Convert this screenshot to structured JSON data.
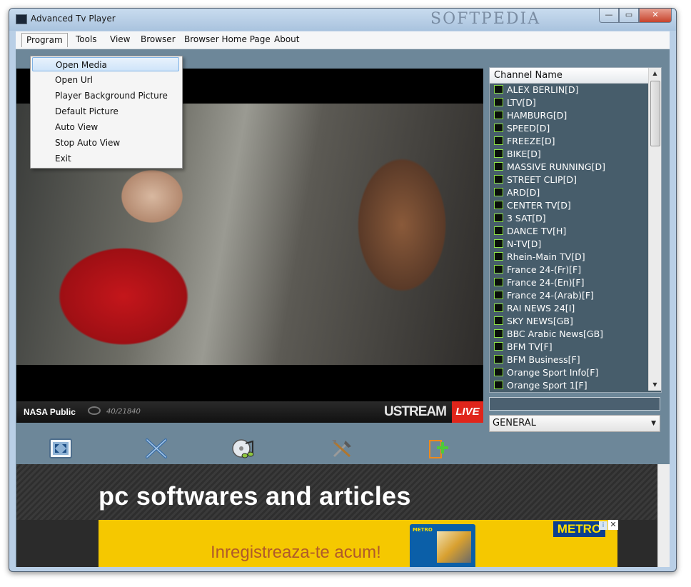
{
  "window": {
    "title": "Advanced Tv Player",
    "watermark": "SOFTPEDIA"
  },
  "window_controls": {
    "minimize": "—",
    "maximize": "▭",
    "close": "✕"
  },
  "menu": {
    "items": [
      "Program",
      "Tools",
      "View",
      "Browser",
      "Browser Home Page",
      "About"
    ],
    "open_menu": "Program",
    "dropdown_items": [
      "Open Media",
      "Open Url",
      "Player Background Picture",
      "Default Picture",
      "Auto View",
      "Stop Auto View",
      "Exit"
    ],
    "highlighted_item": "Open Media"
  },
  "video": {
    "stream_name": "NASA Public",
    "viewers": "40/21840",
    "brand": "USTREAM",
    "live_label": "LIVE"
  },
  "channels": {
    "header": "Channel Name",
    "items": [
      "ALEX BERLIN[D]",
      "LTV[D]",
      "HAMBURG[D]",
      "SPEED[D]",
      "FREEZE[D]",
      "BIKE[D]",
      "MASSIVE RUNNING[D]",
      "STREET CLIP[D]",
      "ARD[D]",
      "CENTER TV[D]",
      "3 SAT[D]",
      "DANCE TV[H]",
      "N-TV[D]",
      "Rhein-Main TV[D]",
      "France 24-(Fr)[F]",
      "France 24-(En)[F]",
      "France 24-(Arab)[F]",
      "RAI NEWS 24[I]",
      "SKY NEWS[GB]",
      "BBC Arabic News[GB]",
      "BFM TV[F]",
      "BFM Business[F]",
      "Orange Sport Info[F]",
      "Orange Sport 1[F]"
    ],
    "search_value": "",
    "category": "GENERAL"
  },
  "toolbar": {
    "icons": [
      "fullscreen-icon",
      "cross-arrows-icon",
      "music-disc-icon",
      "tools-icon",
      "add-file-icon"
    ]
  },
  "browser": {
    "site_title": "pc softwares and articles",
    "ad_text": "Inregistreaza-te acum!",
    "ad_logo": "METRO",
    "ad_card_logo": "METRO",
    "ad_info": "i",
    "ad_close": "✕"
  },
  "colors": {
    "accent": "#e0251b",
    "ad_bg": "#f5c800",
    "client_bg": "#6d8799"
  }
}
